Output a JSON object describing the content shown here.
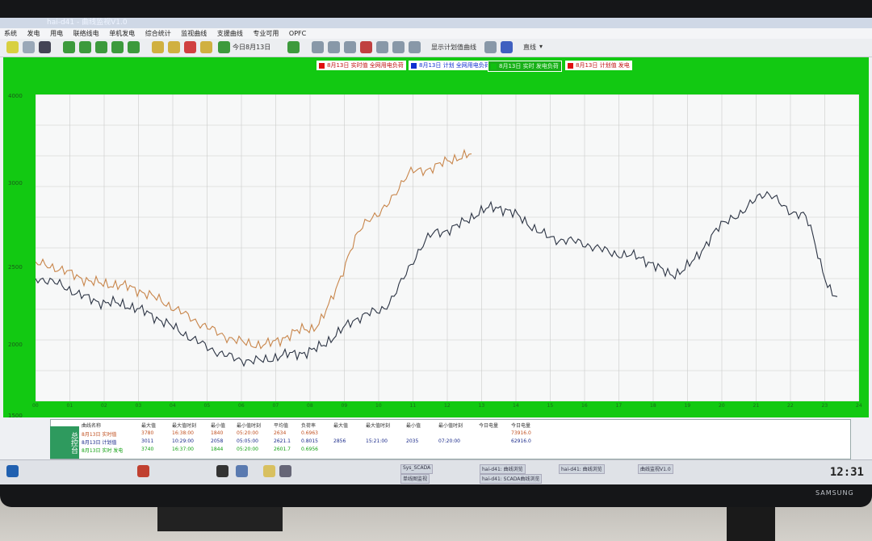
{
  "window": {
    "title": "hai-d41 - 曲线监视V1.0"
  },
  "menu": [
    "系统",
    "发电",
    "用电",
    "联络线电",
    "单机发电",
    "综合统计",
    "监视曲线",
    "支援曲线",
    "专业可用",
    "OPFC"
  ],
  "toolbar": {
    "date_label": "今日8月13日",
    "view_label": "显示计划值曲线",
    "mode_label": "直线"
  },
  "chart": {
    "legend": [
      {
        "label": "8月13日 实时值 全网用电负荷",
        "color": "#e01010"
      },
      {
        "label": "8月13日 计划 全网用电负荷",
        "color": "#1030d0"
      },
      {
        "label": "8月13日 实时 发电负荷",
        "color": "#10c010"
      },
      {
        "label": "8月13日 计划值 发电",
        "color": "#e01010"
      }
    ],
    "y_ticks": [
      "4000",
      "3000",
      "2500",
      "2000",
      "1500"
    ],
    "x_ticks": [
      "00",
      "01",
      "02",
      "03",
      "04",
      "05",
      "06",
      "07",
      "08",
      "09",
      "10",
      "11",
      "12",
      "13",
      "14",
      "15",
      "16",
      "17",
      "18",
      "19",
      "20",
      "21",
      "22",
      "23",
      "24"
    ]
  },
  "table": {
    "headers": [
      "曲线名称",
      "最大值",
      "最大值时刻",
      "最小值",
      "最小值时刻",
      "平均值",
      "负荷率",
      "最大值",
      "最大值时刻",
      "最小值",
      "最小值时刻",
      "今日电量",
      "今日电量"
    ],
    "rows": [
      [
        "8月13日 实时值",
        "3780",
        "16:38:00",
        "1840",
        "05:20:00",
        "2634",
        "0.6963",
        "",
        "",
        "",
        "",
        "",
        "73916.0"
      ],
      [
        "8月13日 计划值",
        "3011",
        "10:29:00",
        "2058",
        "05:05:00",
        "2621.1",
        "0.8015",
        "2856",
        "15:21:00",
        "2035",
        "07:20:00",
        "",
        "62916.0"
      ],
      [
        "8月13日 实时 发电",
        "3740",
        "16:37:00",
        "1844",
        "05:20:00",
        "2601.7",
        "0.6956",
        "",
        "",
        "",
        "",
        "",
        ""
      ]
    ]
  },
  "left_panel": {
    "label": "总控台"
  },
  "taskbar": {
    "items": [
      "Sys_SCADA",
      "单线图监视",
      "hai-d41: 曲线浏览",
      "hai-d41: SCADA曲线浏览",
      "hai-d41: 曲线浏览",
      "曲线监视V1.0"
    ],
    "clock": "12:31"
  },
  "monitor": {
    "brand": "SAMSUNG"
  }
}
